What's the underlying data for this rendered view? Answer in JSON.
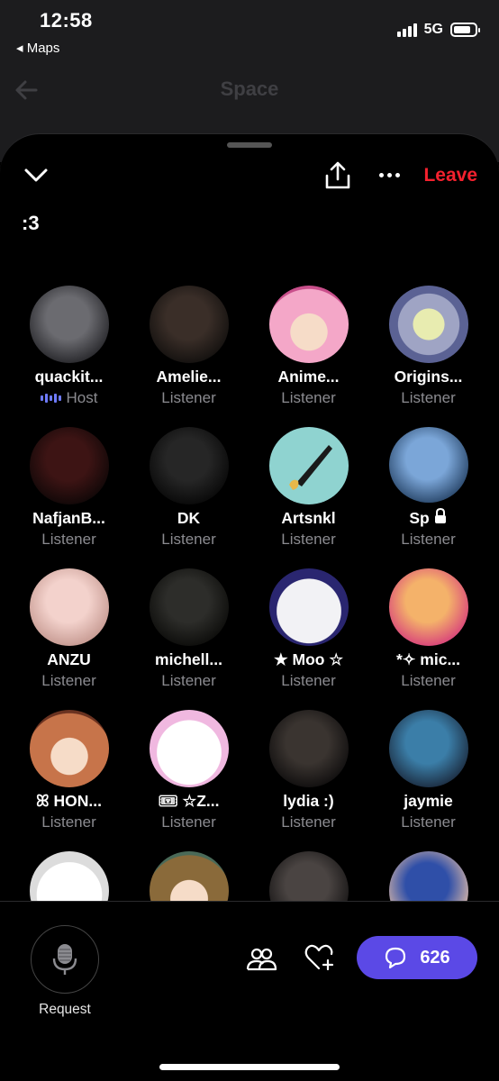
{
  "status_bar": {
    "time": "12:58",
    "back_app": "◂ Maps",
    "network": "5G"
  },
  "underlying_screen": {
    "title": "Space"
  },
  "header": {
    "leave_label": "Leave",
    "space_title": ":3"
  },
  "participants": [
    {
      "name": "quackit...",
      "role": "Host",
      "is_host": true,
      "colors": [
        "#6b6b70",
        "#2a2a2e"
      ],
      "avatar": "photo"
    },
    {
      "name": "Amelie...",
      "role": "Listener",
      "colors": [
        "#3a2e28",
        "#151210"
      ],
      "avatar": "photo"
    },
    {
      "name": "Anime...",
      "role": "Listener",
      "colors": [
        "#f4a7c8",
        "#c94f8b"
      ],
      "avatar": "anime"
    },
    {
      "name": "Origins...",
      "role": "Listener",
      "colors": [
        "#9fa4c4",
        "#5b6294"
      ],
      "avatar": "pixel"
    },
    {
      "name": "NafjanB...",
      "role": "Listener",
      "colors": [
        "#3d1414",
        "#120808"
      ],
      "avatar": "photo"
    },
    {
      "name": "DK",
      "role": "Listener",
      "colors": [
        "#262626",
        "#0a0a0a"
      ],
      "avatar": "photo"
    },
    {
      "name": "Artsnkl",
      "role": "Listener",
      "colors": [
        "#8fd3d0",
        "#4aa5a1"
      ],
      "avatar": "brush"
    },
    {
      "name": "Sp",
      "role": "Listener",
      "locked": true,
      "colors": [
        "#7ba6d8",
        "#2c4a6e"
      ],
      "avatar": "photo"
    },
    {
      "name": "ANZU",
      "role": "Listener",
      "colors": [
        "#f3d2cc",
        "#c79b93"
      ],
      "avatar": "photo"
    },
    {
      "name": "michell...",
      "role": "Listener",
      "colors": [
        "#2d2d2a",
        "#0e0e0c"
      ],
      "avatar": "photo"
    },
    {
      "name": "★ Moo ☆",
      "role": "Listener",
      "colors": [
        "#f2f2f5",
        "#2a2670"
      ],
      "avatar": "cartoon"
    },
    {
      "name": "*✧ mic...",
      "role": "Listener",
      "colors": [
        "#f4b26a",
        "#d9467a"
      ],
      "avatar": "photo"
    },
    {
      "name": "ꕤ HON...",
      "role": "Listener",
      "colors": [
        "#c7744a",
        "#6a3220"
      ],
      "avatar": "anime"
    },
    {
      "name": "🎟 ☆Z...",
      "role": "Listener",
      "colors": [
        "#ffffff",
        "#f0b8e0"
      ],
      "avatar": "cartoon"
    },
    {
      "name": "lydia :)",
      "role": "Listener",
      "colors": [
        "#3a3430",
        "#121010"
      ],
      "avatar": "photo"
    },
    {
      "name": "jaymie",
      "role": "Listener",
      "colors": [
        "#3b7ea8",
        "#1d2f44"
      ],
      "avatar": "photo"
    },
    {
      "name": "",
      "role": "",
      "colors": [
        "#ffffff",
        "#dcdcdc"
      ],
      "avatar": "cartoon"
    },
    {
      "name": "",
      "role": "",
      "colors": [
        "#8a6a3a",
        "#4a6a58"
      ],
      "avatar": "anime"
    },
    {
      "name": "",
      "role": "",
      "colors": [
        "#4a4442",
        "#181616"
      ],
      "avatar": "photo"
    },
    {
      "name": "",
      "role": "",
      "colors": [
        "#2f4fa8",
        "#d9b6a6"
      ],
      "avatar": "photo"
    }
  ],
  "bottom_bar": {
    "request_label": "Request",
    "chat_count": "626"
  },
  "icons": {
    "collapse": "chevron-down-icon",
    "share": "share-icon",
    "more": "more-icon",
    "request": "microphone-icon",
    "people": "people-icon",
    "heart": "heart-plus-icon",
    "chat": "chat-bubble-icon"
  },
  "colors": {
    "leave": "#f4212e",
    "accent": "#5b49e6",
    "host": "#6e7bff",
    "secondary_text": "#8b8b90"
  }
}
